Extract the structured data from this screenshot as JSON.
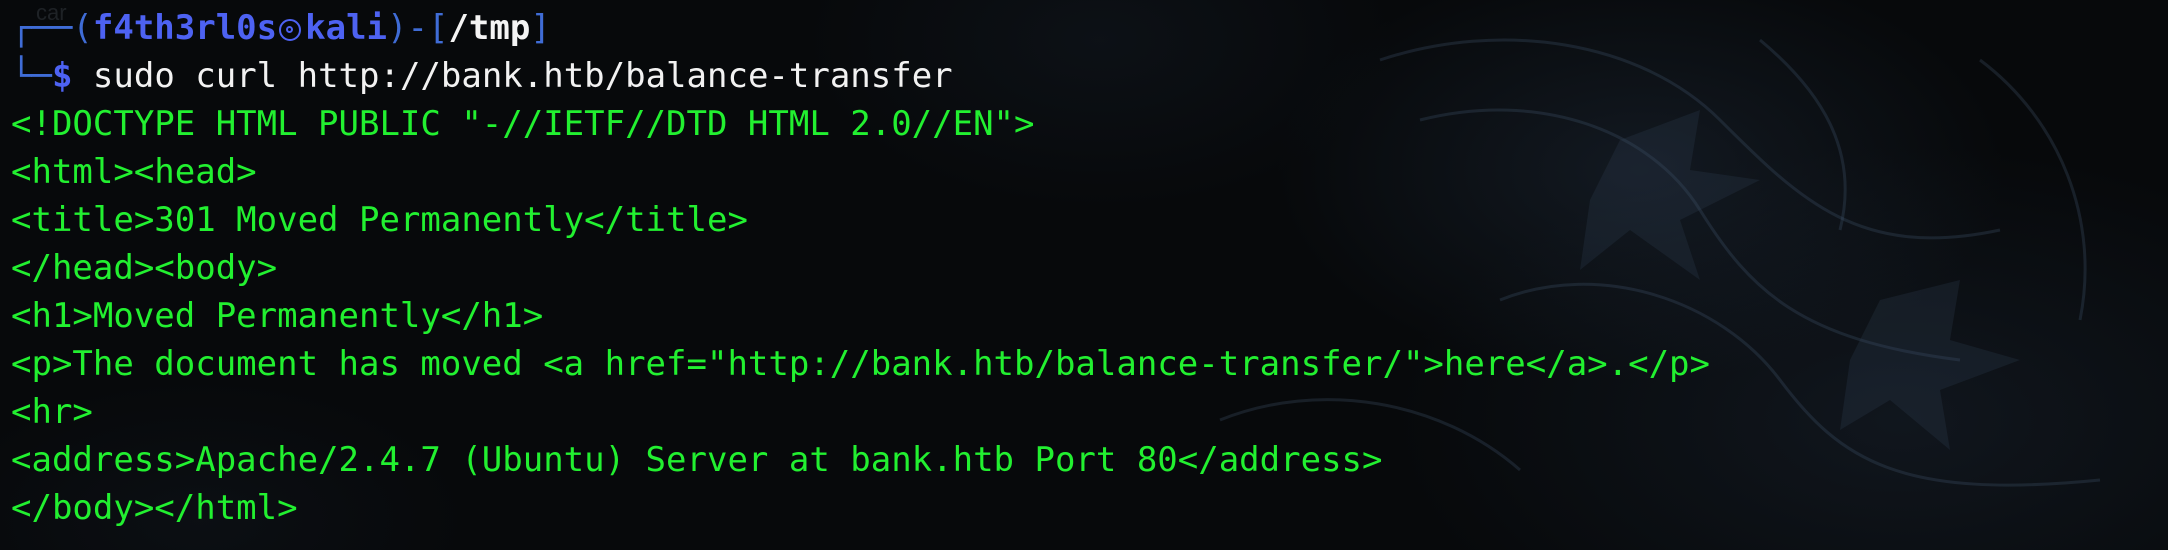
{
  "prompt": {
    "open_bracket": "┌──(",
    "user": "f4th3rl0s",
    "host": "kali",
    "middle": ")-[",
    "path": "/tmp",
    "close": "]",
    "line2_prefix": "└─",
    "dollar": "$",
    "command": " sudo curl http://bank.htb/balance-transfer"
  },
  "output": [
    "<!DOCTYPE HTML PUBLIC \"-//IETF//DTD HTML 2.0//EN\">",
    "<html><head>",
    "<title>301 Moved Permanently</title>",
    "</head><body>",
    "<h1>Moved Permanently</h1>",
    "<p>The document has moved <a href=\"http://bank.htb/balance-transfer/\">here</a>.</p>",
    "<hr>",
    "<address>Apache/2.4.7 (Ubuntu) Server at bank.htb Port 80</address>",
    "</body></html>"
  ],
  "colors": {
    "output_text": "#22f030",
    "prompt_blue": "#4d62f2",
    "command_text": "#f2f2f2",
    "background": "#07090b"
  },
  "icons": [
    "kali-skull-icon"
  ]
}
